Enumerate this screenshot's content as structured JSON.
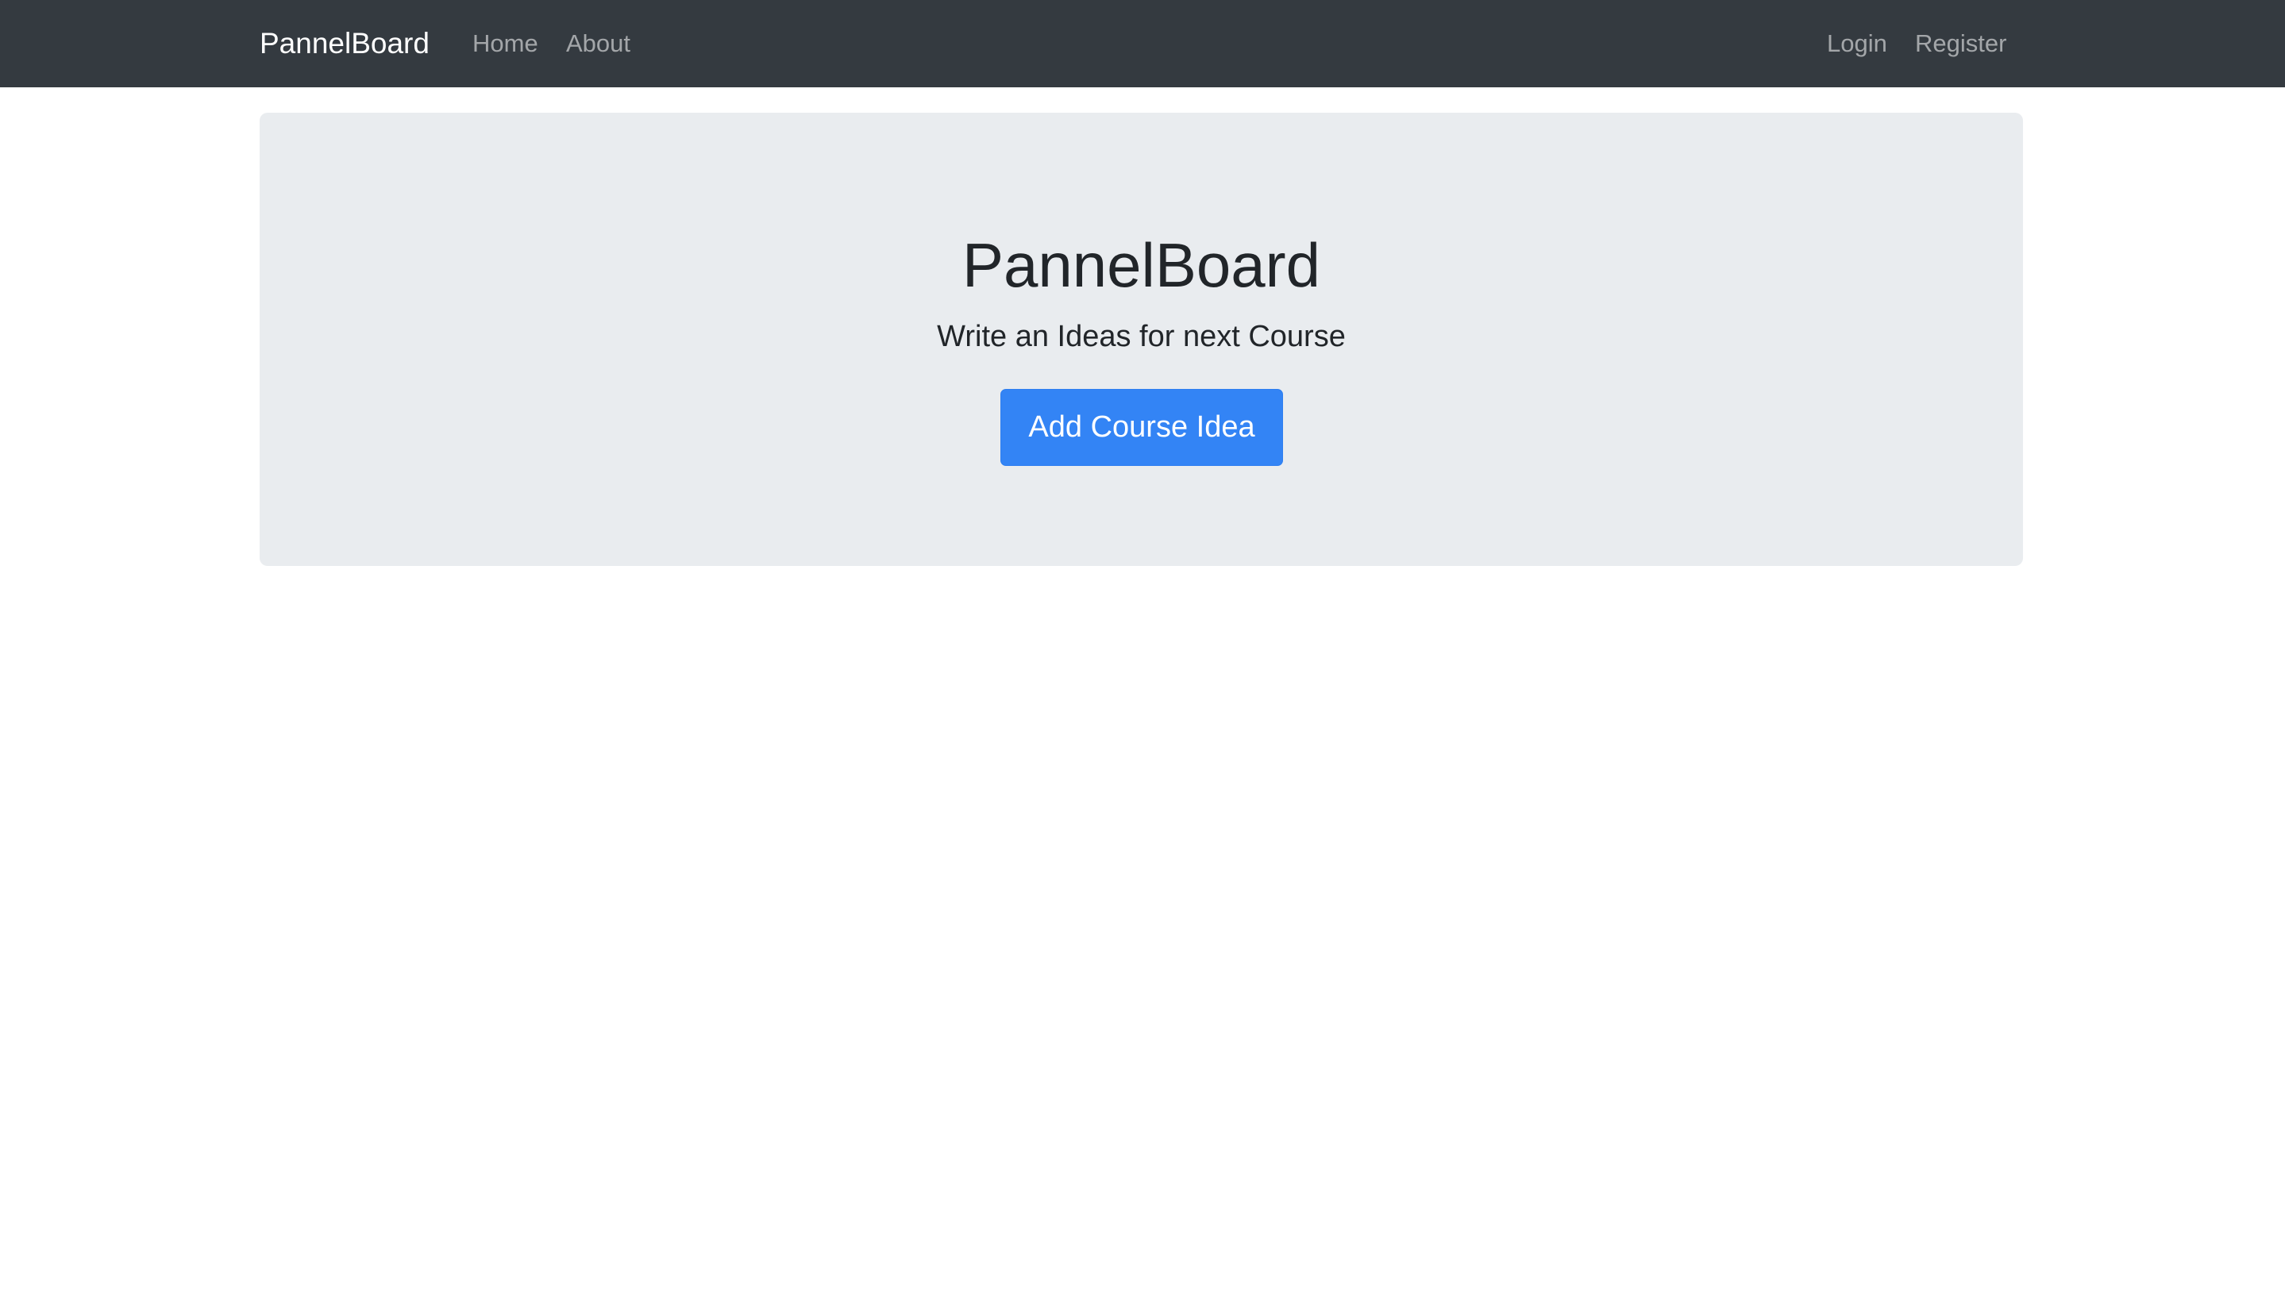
{
  "navbar": {
    "brand": "PannelBoard",
    "left_links": [
      {
        "label": "Home"
      },
      {
        "label": "About"
      }
    ],
    "right_links": [
      {
        "label": "Login"
      },
      {
        "label": "Register"
      }
    ],
    "background_color": "#343a40"
  },
  "jumbotron": {
    "title": "PannelBoard",
    "lead": "Write an Ideas for next Course",
    "button_label": "Add Course Idea",
    "background_color": "#e9ecef",
    "button_color": "#3384f5"
  }
}
